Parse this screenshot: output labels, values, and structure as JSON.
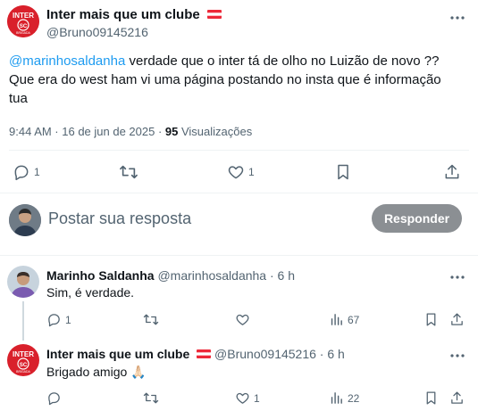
{
  "main_post": {
    "author_name": "Inter mais que um clube",
    "author_handle": "@Bruno09145216",
    "mention": "@marinhosaldanha",
    "text_line1": " verdade que o inter tá de olho no Luizão de novo ??",
    "text_line2": "Que era do west ham vi uma página postando no insta que é informação",
    "text_line3": "tua",
    "timestamp": "9:44 AM · 16 de jun de 2025 · ",
    "views_count": "95",
    "views_label": " Visualizações",
    "replies": "1",
    "likes": "1"
  },
  "compose": {
    "placeholder": "Postar sua resposta",
    "button_label": "Responder"
  },
  "replies": [
    {
      "author_name": "Marinho Saldanha",
      "author_handle": "@marinhosaldanha · 6 h",
      "text": "Sim, é verdade.",
      "replies": "1",
      "views": "67"
    },
    {
      "author_name": "Inter mais que um clube",
      "author_handle": "@Bruno09145216 · 6 h",
      "text": "Brigado amigo 🙏🏻",
      "likes": "1",
      "views": "22"
    }
  ],
  "colors": {
    "inter_red": "#d9202b",
    "link_blue": "#1d9bf0",
    "muted": "#536471"
  }
}
